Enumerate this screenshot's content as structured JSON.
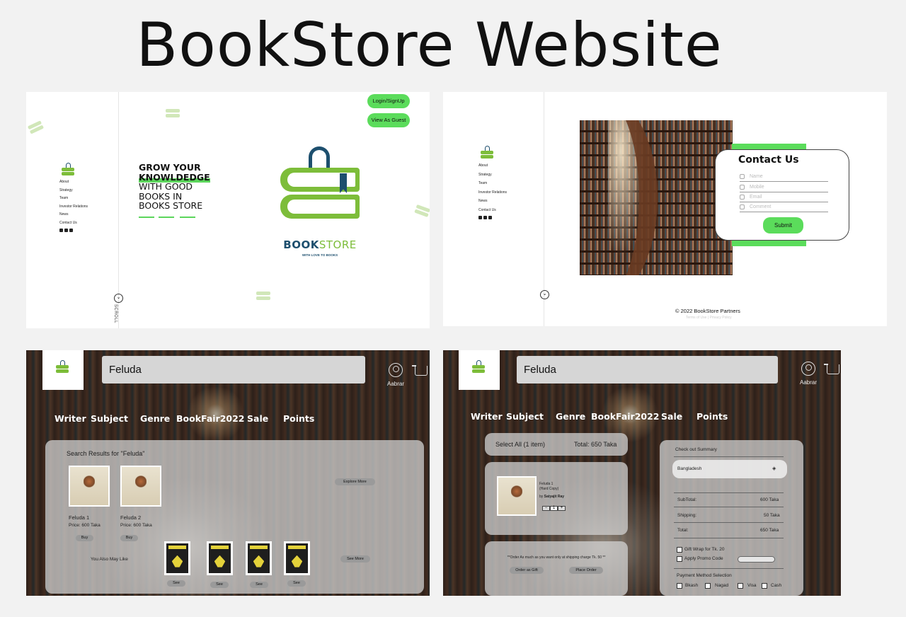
{
  "page": {
    "title": "BookStore Website"
  },
  "sidenav": {
    "items": [
      "About",
      "Strategy",
      "Team",
      "Investor Relations",
      "News",
      "Contact Us"
    ],
    "socials": [
      "facebook-icon",
      "instagram-icon",
      "twitter-icon"
    ]
  },
  "landing": {
    "hero_line1": "GROW YOUR",
    "hero_line2": "KNOWLDEDGE",
    "hero_line3": "WITH GOOD",
    "hero_line4": "BOOKS IN",
    "hero_line5": "BOOKS STORE",
    "login_label": "Login/SignUp",
    "guest_label": "View As Guest",
    "brand_a": "BOOK",
    "brand_b": "STORE",
    "tagline": "WITH LOVE TO BOOKS",
    "scroll_label": "SCROLL",
    "scroll_icon": "chevron-down-icon"
  },
  "contact": {
    "title": "Contact Us",
    "fields": [
      "Name",
      "Mobile",
      "Email",
      "Comment"
    ],
    "submit_label": "Submit",
    "copyright": "© 2022 BookStore Partners",
    "links": "Terms of Use | Privacy Policy"
  },
  "header": {
    "search_value": "Feluda",
    "user_name": "Aabrar",
    "nav": [
      "Writer",
      "Subject",
      "Genre",
      "BookFair2022",
      "Sale",
      "Points"
    ]
  },
  "search": {
    "heading": "Search Results for \"Feluda\"",
    "results": [
      {
        "title": "Feluda 1",
        "price": "Price: 600 Taka",
        "buy": "Buy"
      },
      {
        "title": "Feluda 2",
        "price": "Price: 600 Taka",
        "buy": "Buy"
      }
    ],
    "explore_label": "Explore More",
    "also_like": "You Also May Like",
    "see_label": "See",
    "see_more_label": "See More"
  },
  "cart": {
    "select_all": "Select All (1 item)",
    "total": "Total: 650 Taka",
    "item_title": "Feluda 1",
    "item_type": "(Hard Copy)",
    "item_by": "by",
    "item_author": "Satyajit Ray",
    "qty_minus": "−",
    "qty": "1",
    "qty_plus": "+",
    "note": "**Order As much as you want only at shipping charge Tk. 50 **",
    "gift_btn": "Order as Gift",
    "place_btn": "Place Order"
  },
  "checkout": {
    "title": "Check out Summary",
    "country": "Bangladesh",
    "rows": [
      {
        "label": "SubTotal:",
        "value": "600 Taka"
      },
      {
        "label": "Shipping:",
        "value": "50 Taka"
      },
      {
        "label": "Total:",
        "value": "650 Taka"
      }
    ],
    "gift_wrap": "Gift Wrap for Tk. 20",
    "promo": "Apply Promo Code",
    "payment_title": "Payment Method Selection",
    "payments": [
      "Bkash",
      "Nagad",
      "Visa",
      "Cash"
    ]
  },
  "colors": {
    "accent_green": "#5bdc5b",
    "brand_navy": "#1d4f6e",
    "brand_green": "#7dbd3a"
  }
}
